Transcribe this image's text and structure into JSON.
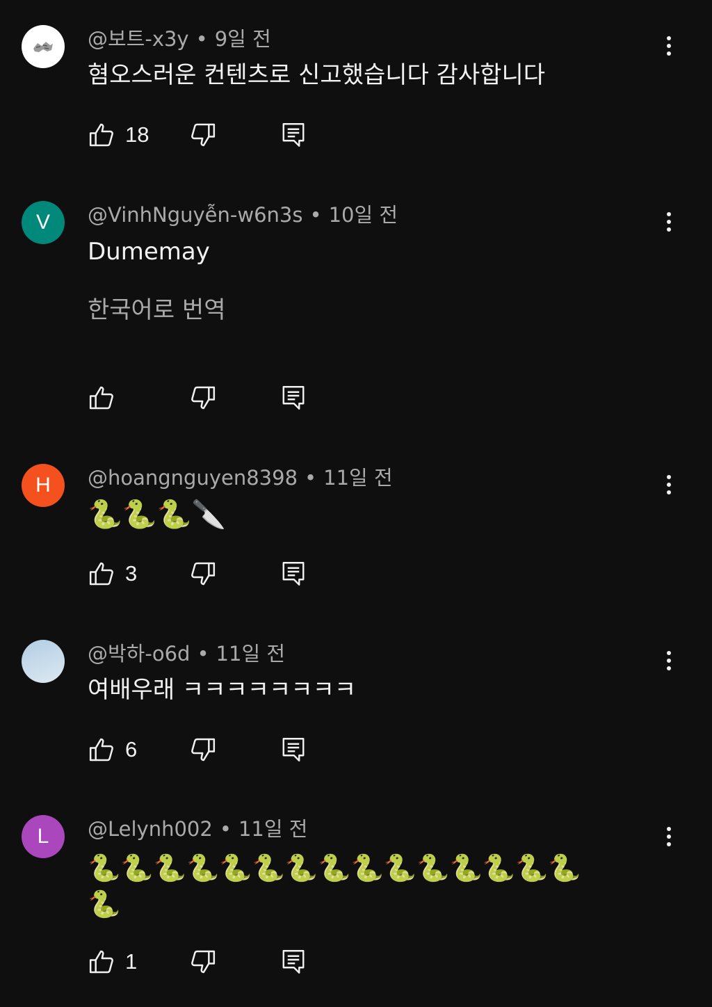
{
  "comments": [
    {
      "author": "@보트-x3y",
      "time": "9일 전",
      "text": "혐오스러운 컨텐츠로 신고했습니다 감사합니다",
      "likes": "18",
      "avatar_letter": "",
      "avatar_color": "#ffffff"
    },
    {
      "author": "@VinhNguyễn-w6n3s",
      "time": "10일 전",
      "text": "Dumemay",
      "translate_label": "한국어로 번역",
      "likes": "",
      "avatar_letter": "V",
      "avatar_color": "#00897b"
    },
    {
      "author": "@hoangnguyen8398",
      "time": "11일 전",
      "text": "🐍🐍🐍🔪",
      "likes": "3",
      "avatar_letter": "H",
      "avatar_color": "#f4511e"
    },
    {
      "author": "@박하-o6d",
      "time": "11일 전",
      "text": "여배우래 ㅋㅋㅋㅋㅋㅋㅋㅋ",
      "likes": "6",
      "avatar_letter": "",
      "avatar_color": "#c5dae8"
    },
    {
      "author": "@Lelynh002",
      "time": "11일 전",
      "text_line1": "🐍🐍🐍🐍🐍🐍🐍🐍🐍🐍🐍🐍🐍🐍🐍",
      "text_line2": "🐍",
      "likes": "1",
      "avatar_letter": "L",
      "avatar_color": "#ab47bc"
    }
  ],
  "separator": "•",
  "icons": {
    "like": "thumbs-up-icon",
    "dislike": "thumbs-down-icon",
    "reply": "reply-comment-icon",
    "more": "more-vertical-icon"
  }
}
